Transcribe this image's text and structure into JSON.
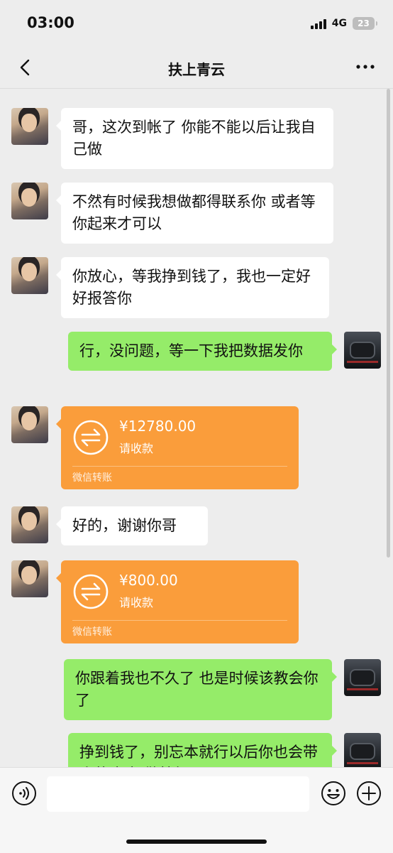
{
  "status_bar": {
    "time": "03:00",
    "network": "4G",
    "battery": "23"
  },
  "nav": {
    "title": "扶上青云",
    "back_icon": "chevron-left-icon",
    "more_icon": "more-dots-icon"
  },
  "messages": [
    {
      "side": "left",
      "type": "text",
      "text": "哥，这次到帐了 你能不能以后让我自己做"
    },
    {
      "side": "left",
      "type": "text",
      "text": "不然有时候我想做都得联系你 或者等你起来才可以"
    },
    {
      "side": "left",
      "type": "text",
      "text": "你放心，等我挣到钱了，我也一定好好报答你"
    },
    {
      "side": "right",
      "type": "text",
      "text": "行，没问题，等一下我把数据发你"
    },
    {
      "side": "left",
      "type": "transfer",
      "amount": "¥12780.00",
      "status": "请收款",
      "label": "微信转账"
    },
    {
      "side": "left",
      "type": "text",
      "text": "好的，谢谢你哥"
    },
    {
      "side": "left",
      "type": "transfer",
      "amount": "¥800.00",
      "status": "请收款",
      "label": "微信转账"
    },
    {
      "side": "right",
      "type": "text",
      "text": "你跟着我也不久了 也是时候该教会你了"
    },
    {
      "side": "right",
      "type": "text",
      "text": "挣到钱了，别忘本就行以后你也会带人的 好好做就行"
    }
  ],
  "colors": {
    "background": "#ededed",
    "incoming_bubble": "#ffffff",
    "outgoing_bubble": "#95ec69",
    "transfer_card": "#fa9d3b"
  },
  "input_bar": {
    "voice_icon": "voice-icon",
    "emoji_icon": "emoji-icon",
    "plus_icon": "plus-icon"
  }
}
